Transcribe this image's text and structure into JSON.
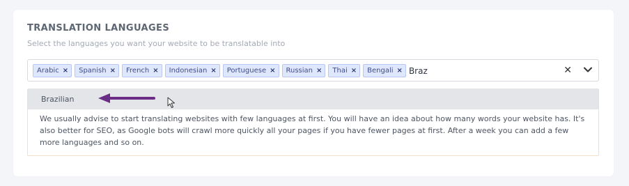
{
  "section": {
    "title": "TRANSLATION LANGUAGES",
    "subtitle": "Select the languages you want your website to be translatable into"
  },
  "selector": {
    "tags": [
      {
        "label": "Arabic"
      },
      {
        "label": "Spanish"
      },
      {
        "label": "French"
      },
      {
        "label": "Indonesian"
      },
      {
        "label": "Portuguese"
      },
      {
        "label": "Russian"
      },
      {
        "label": "Thai"
      },
      {
        "label": "Bengali"
      }
    ],
    "remove_glyph": "×",
    "typed_value": "Braz",
    "clear_glyph": "✕"
  },
  "dropdown": {
    "options": [
      {
        "label": "Brazilian"
      }
    ],
    "note": "We usually advise to start translating websites with few languages at first. You will have an idea about how many words your website has. It's also better for SEO, as Google bots will crawl more quickly all your pages if you have fewer pages at first. After a week you can add a few more languages and so on."
  },
  "colors": {
    "tag_background": "#dfe7fc",
    "tag_border": "#b8c7f2",
    "option_highlight": "#e3e5e8",
    "annotation_arrow": "#6b2c85"
  },
  "icons": {
    "clear": "close-icon",
    "expand": "chevron-down-icon",
    "tag_remove": "remove-tag-icon",
    "annotation": "arrow-left-icon",
    "pointer": "mouse-cursor-icon"
  }
}
